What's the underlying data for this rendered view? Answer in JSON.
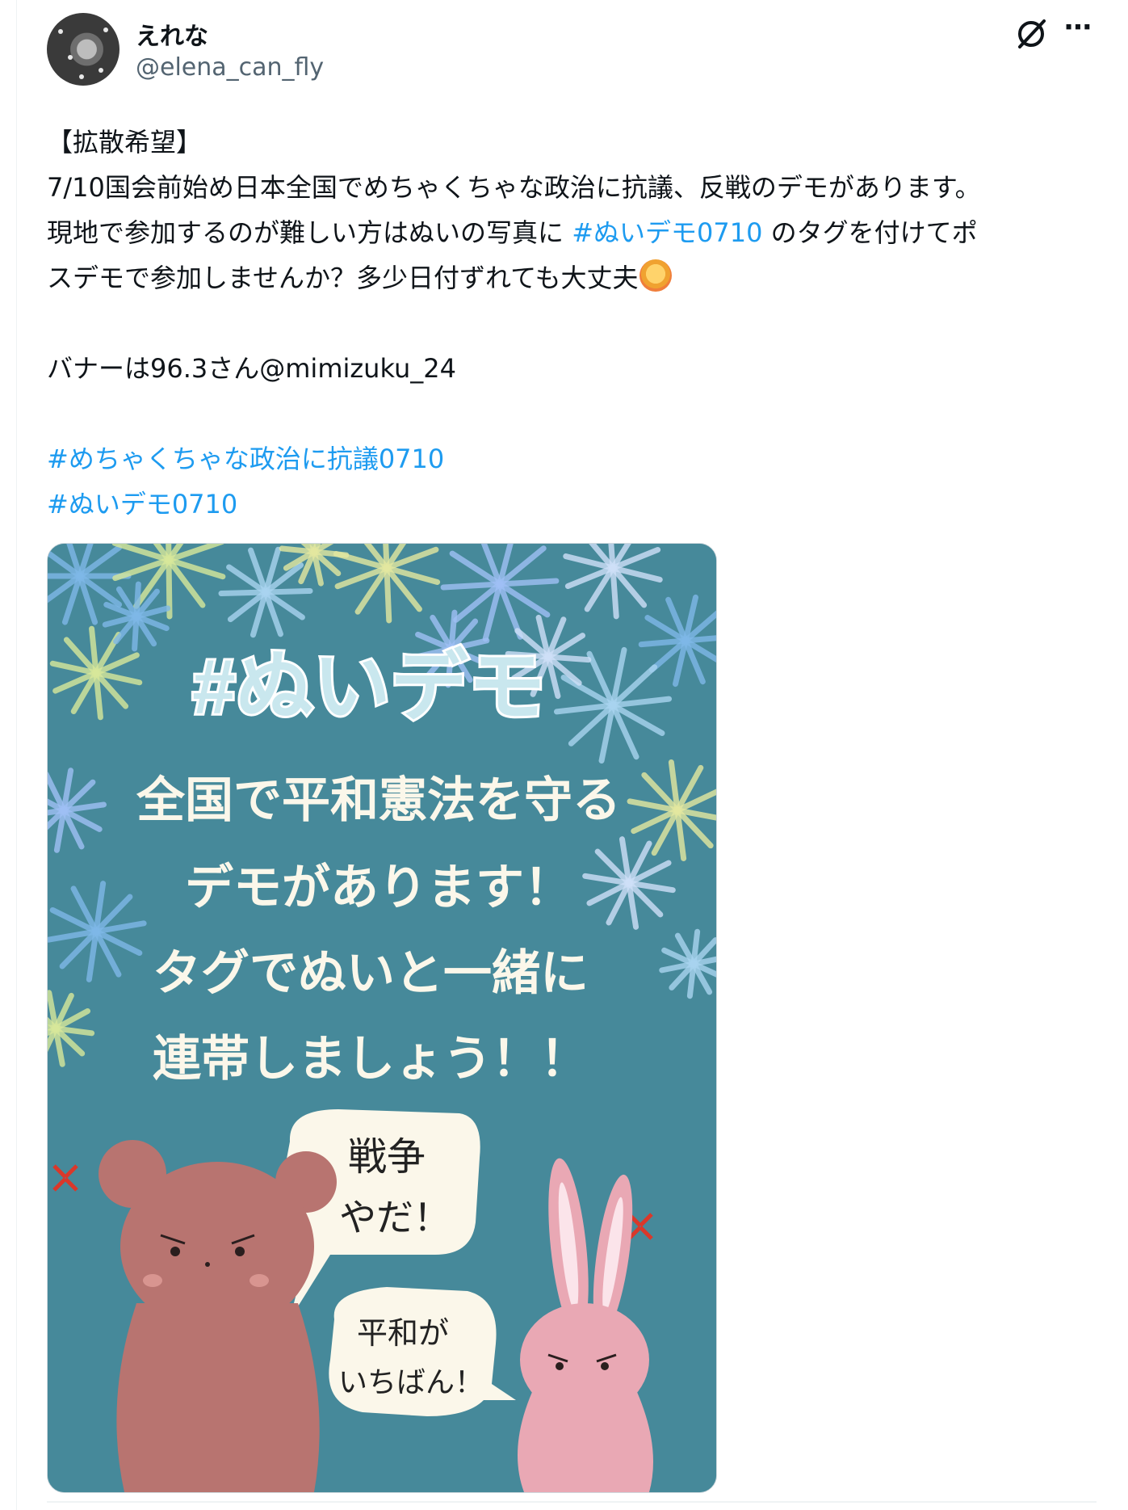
{
  "post": {
    "display_name": "えれな",
    "handle": "@elena_can_fly",
    "body_lines": [
      {
        "parts": [
          {
            "t": "【拡散希望】"
          }
        ]
      },
      {
        "parts": [
          {
            "t": "7/10国会前始め日本全国でめちゃくちゃな政治に抗議、反戦のデモがあります。"
          }
        ]
      },
      {
        "parts": [
          {
            "t": "現地で参加するのが難しい方はぬいの写真に "
          },
          {
            "t": "#ぬいデモ0710",
            "tag": true
          },
          {
            "t": " のタグを付けてポ"
          }
        ]
      },
      {
        "parts": [
          {
            "t": "スデモで参加しませんか？多少日付ずれても大丈夫"
          },
          {
            "emoji": "person-gesturing-ok-emoji"
          }
        ]
      },
      {
        "gap": true
      },
      {
        "parts": [
          {
            "t": "バナーは96.3さん@mimizuku_24"
          }
        ]
      },
      {
        "gap": true
      },
      {
        "parts": [
          {
            "t": "#めちゃくちゃな政治に抗議0710",
            "tag": true
          }
        ]
      },
      {
        "parts": [
          {
            "t": "#ぬいデモ0710",
            "tag": true
          }
        ]
      }
    ]
  },
  "banner": {
    "title": "#ぬいデモ",
    "lines": [
      "全国で平和憲法を守る",
      "デモがあります！",
      "タグでぬいと一緒に",
      "連帯しましょう！！"
    ],
    "bubble_bear": [
      "戦争",
      "やだ！"
    ],
    "bubble_rabbit": [
      "平和が",
      "いちばん！"
    ]
  },
  "icons": {
    "grok": "grok-icon",
    "more": "more-options-icon",
    "emoji": "person-gesturing-ok-emoji"
  },
  "colors": {
    "link": "#1d9bf0",
    "banner_bg": "#46899a",
    "bear": "#b87470",
    "rabbit": "#e9a8b4",
    "banner_text": "#fbf7ea"
  }
}
